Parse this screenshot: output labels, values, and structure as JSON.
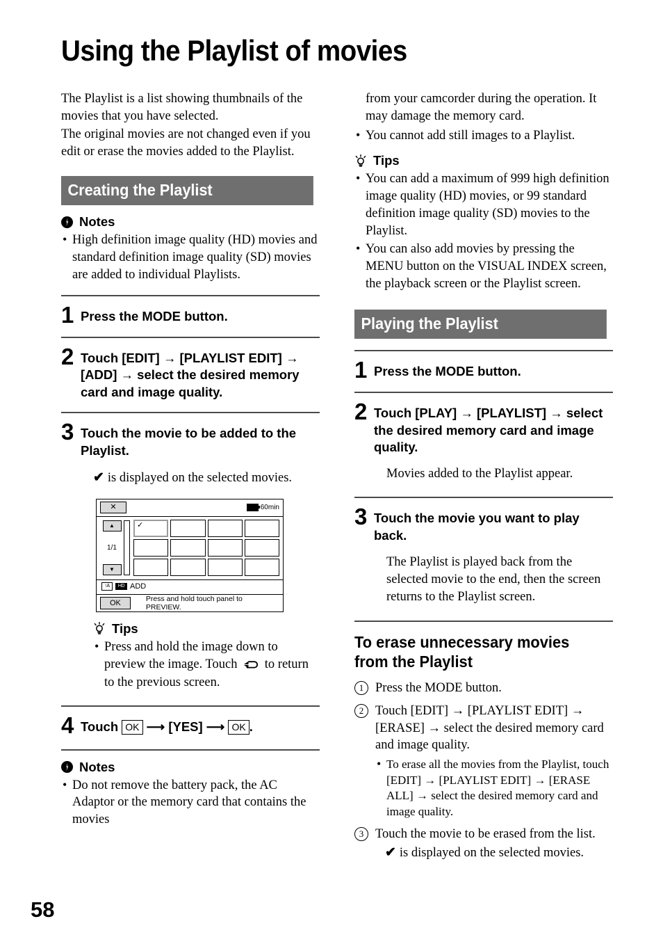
{
  "page": {
    "title": "Using the Playlist of movies",
    "number": "58"
  },
  "left_column": {
    "intro": "The Playlist is a list showing thumbnails of the movies that you have selected.\nThe original movies are not changed even if you edit or erase the movies added to the Playlist.",
    "intro_line1": "The Playlist is a list showing thumbnails of the movies that you have selected.",
    "intro_line2": "The original movies are not changed even if you edit or erase the movies added to the Playlist.",
    "section_title": "Creating the Playlist",
    "notes_heading": "Notes",
    "notes_items": [
      "High definition image quality (HD) movies and standard definition image quality (SD) movies are added to individual Playlists."
    ],
    "steps": [
      {
        "num": "1",
        "text": "Press the MODE button."
      },
      {
        "num": "2",
        "text": "Touch [EDIT] → [PLAYLIST EDIT] → [ADD] → select the desired memory card and image quality."
      },
      {
        "num": "3",
        "text": "Touch the movie to be added to the Playlist.",
        "note": "is displayed on the selected movies."
      },
      {
        "num": "4",
        "text_before": "Touch",
        "ok_label": "OK",
        "text_middle": "[YES]",
        "text_after": "."
      }
    ],
    "tips_heading": "Tips",
    "tips_items_part1": "Press and hold the image down to preview the image. Touch",
    "tips_items_part2": "to return to the previous screen.",
    "notes2_heading": "Notes",
    "notes2_items": [
      "Do not remove the battery pack, the AC Adaptor or the memory card that contains the movies"
    ]
  },
  "lcd": {
    "close_label": "✕",
    "battery_text": "60min",
    "up_label": "▲",
    "down_label": "▼",
    "page_label": "1/1",
    "selected_check": "✓",
    "flash_label": "↑A",
    "quality_label": "HD",
    "status_label": "ADD",
    "ok_label": "OK",
    "hint_text": "Press and hold touch panel to PREVIEW."
  },
  "right_column": {
    "notes_continuation": "from your camcorder during the operation. It may damage the memory card.",
    "notes_items": [
      "You cannot add still images to a Playlist."
    ],
    "tips_heading": "Tips",
    "tips_items": [
      "You can add a maximum of 999 high definition image quality (HD) movies, or 99 standard definition image quality (SD) movies to the Playlist.",
      "You can also add movies by pressing the MENU button on the VISUAL INDEX screen, the playback screen or the Playlist screen."
    ],
    "section_title": "Playing the Playlist",
    "steps": [
      {
        "num": "1",
        "text": "Press the MODE button."
      },
      {
        "num": "2",
        "text": "Touch [PLAY] → [PLAYLIST] → select the desired memory card and image quality.",
        "note": "Movies added to the Playlist appear."
      },
      {
        "num": "3",
        "text": "Touch the movie you want to play back.",
        "note": "The Playlist is played back from the selected movie to the end, then the screen returns to the Playlist screen."
      }
    ],
    "subhead": "To erase unnecessary movies from the Playlist",
    "erase_steps": [
      {
        "num": "①",
        "text": "Press the MODE button."
      },
      {
        "num": "②",
        "text": "Touch [EDIT] → [PLAYLIST EDIT] → [ERASE] → select the desired memory card and image quality."
      },
      {
        "num": "③",
        "text": "Touch the movie to be erased from the list.",
        "note": "is displayed on the selected movies."
      }
    ],
    "erase_sub_bullet": "To erase all the movies from the Playlist, touch [EDIT] → [PLAYLIST EDIT] → [ERASE ALL] → select the desired memory card and image quality."
  },
  "colors": {
    "section_bar_bg": "#6f6f6f",
    "rule": "#4a4a4a",
    "button_face": "#d9d9d9"
  }
}
